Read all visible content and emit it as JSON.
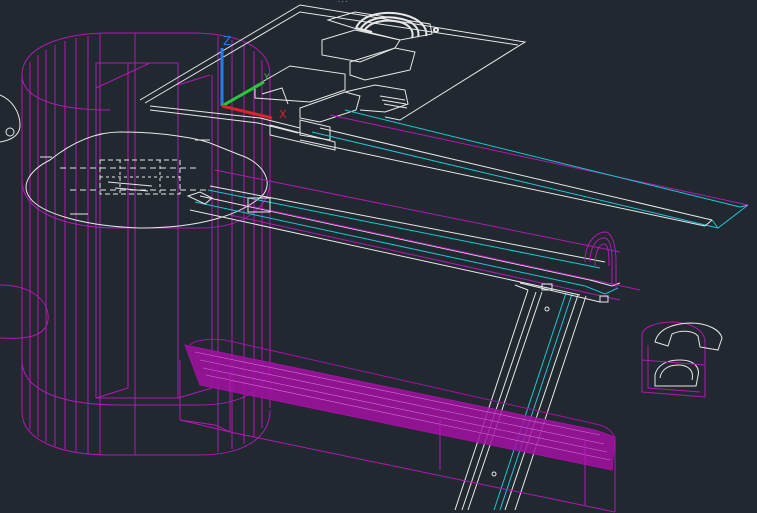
{
  "viewport": {
    "background": "#212830"
  },
  "colors": {
    "magenta": "#b01ab0",
    "magenta_fill": "#a311a3",
    "white": "#e8e8e8",
    "cyan": "#19c8d0",
    "axis_x": "#e0202a",
    "axis_y": "#28c83a",
    "axis_z": "#2a7ae8"
  },
  "ucs_icon": {
    "x_label": "X",
    "y_label": "Y",
    "z_label": "Z"
  }
}
